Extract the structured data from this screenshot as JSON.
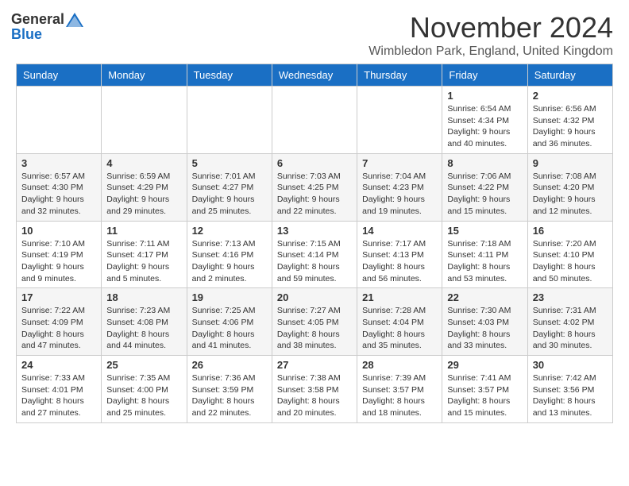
{
  "header": {
    "logo_general": "General",
    "logo_blue": "Blue",
    "month_title": "November 2024",
    "location": "Wimbledon Park, England, United Kingdom"
  },
  "calendar": {
    "columns": [
      "Sunday",
      "Monday",
      "Tuesday",
      "Wednesday",
      "Thursday",
      "Friday",
      "Saturday"
    ],
    "weeks": [
      [
        {
          "day": "",
          "info": ""
        },
        {
          "day": "",
          "info": ""
        },
        {
          "day": "",
          "info": ""
        },
        {
          "day": "",
          "info": ""
        },
        {
          "day": "",
          "info": ""
        },
        {
          "day": "1",
          "info": "Sunrise: 6:54 AM\nSunset: 4:34 PM\nDaylight: 9 hours and 40 minutes."
        },
        {
          "day": "2",
          "info": "Sunrise: 6:56 AM\nSunset: 4:32 PM\nDaylight: 9 hours and 36 minutes."
        }
      ],
      [
        {
          "day": "3",
          "info": "Sunrise: 6:57 AM\nSunset: 4:30 PM\nDaylight: 9 hours and 32 minutes."
        },
        {
          "day": "4",
          "info": "Sunrise: 6:59 AM\nSunset: 4:29 PM\nDaylight: 9 hours and 29 minutes."
        },
        {
          "day": "5",
          "info": "Sunrise: 7:01 AM\nSunset: 4:27 PM\nDaylight: 9 hours and 25 minutes."
        },
        {
          "day": "6",
          "info": "Sunrise: 7:03 AM\nSunset: 4:25 PM\nDaylight: 9 hours and 22 minutes."
        },
        {
          "day": "7",
          "info": "Sunrise: 7:04 AM\nSunset: 4:23 PM\nDaylight: 9 hours and 19 minutes."
        },
        {
          "day": "8",
          "info": "Sunrise: 7:06 AM\nSunset: 4:22 PM\nDaylight: 9 hours and 15 minutes."
        },
        {
          "day": "9",
          "info": "Sunrise: 7:08 AM\nSunset: 4:20 PM\nDaylight: 9 hours and 12 minutes."
        }
      ],
      [
        {
          "day": "10",
          "info": "Sunrise: 7:10 AM\nSunset: 4:19 PM\nDaylight: 9 hours and 9 minutes."
        },
        {
          "day": "11",
          "info": "Sunrise: 7:11 AM\nSunset: 4:17 PM\nDaylight: 9 hours and 5 minutes."
        },
        {
          "day": "12",
          "info": "Sunrise: 7:13 AM\nSunset: 4:16 PM\nDaylight: 9 hours and 2 minutes."
        },
        {
          "day": "13",
          "info": "Sunrise: 7:15 AM\nSunset: 4:14 PM\nDaylight: 8 hours and 59 minutes."
        },
        {
          "day": "14",
          "info": "Sunrise: 7:17 AM\nSunset: 4:13 PM\nDaylight: 8 hours and 56 minutes."
        },
        {
          "day": "15",
          "info": "Sunrise: 7:18 AM\nSunset: 4:11 PM\nDaylight: 8 hours and 53 minutes."
        },
        {
          "day": "16",
          "info": "Sunrise: 7:20 AM\nSunset: 4:10 PM\nDaylight: 8 hours and 50 minutes."
        }
      ],
      [
        {
          "day": "17",
          "info": "Sunrise: 7:22 AM\nSunset: 4:09 PM\nDaylight: 8 hours and 47 minutes."
        },
        {
          "day": "18",
          "info": "Sunrise: 7:23 AM\nSunset: 4:08 PM\nDaylight: 8 hours and 44 minutes."
        },
        {
          "day": "19",
          "info": "Sunrise: 7:25 AM\nSunset: 4:06 PM\nDaylight: 8 hours and 41 minutes."
        },
        {
          "day": "20",
          "info": "Sunrise: 7:27 AM\nSunset: 4:05 PM\nDaylight: 8 hours and 38 minutes."
        },
        {
          "day": "21",
          "info": "Sunrise: 7:28 AM\nSunset: 4:04 PM\nDaylight: 8 hours and 35 minutes."
        },
        {
          "day": "22",
          "info": "Sunrise: 7:30 AM\nSunset: 4:03 PM\nDaylight: 8 hours and 33 minutes."
        },
        {
          "day": "23",
          "info": "Sunrise: 7:31 AM\nSunset: 4:02 PM\nDaylight: 8 hours and 30 minutes."
        }
      ],
      [
        {
          "day": "24",
          "info": "Sunrise: 7:33 AM\nSunset: 4:01 PM\nDaylight: 8 hours and 27 minutes."
        },
        {
          "day": "25",
          "info": "Sunrise: 7:35 AM\nSunset: 4:00 PM\nDaylight: 8 hours and 25 minutes."
        },
        {
          "day": "26",
          "info": "Sunrise: 7:36 AM\nSunset: 3:59 PM\nDaylight: 8 hours and 22 minutes."
        },
        {
          "day": "27",
          "info": "Sunrise: 7:38 AM\nSunset: 3:58 PM\nDaylight: 8 hours and 20 minutes."
        },
        {
          "day": "28",
          "info": "Sunrise: 7:39 AM\nSunset: 3:57 PM\nDaylight: 8 hours and 18 minutes."
        },
        {
          "day": "29",
          "info": "Sunrise: 7:41 AM\nSunset: 3:57 PM\nDaylight: 8 hours and 15 minutes."
        },
        {
          "day": "30",
          "info": "Sunrise: 7:42 AM\nSunset: 3:56 PM\nDaylight: 8 hours and 13 minutes."
        }
      ]
    ]
  }
}
